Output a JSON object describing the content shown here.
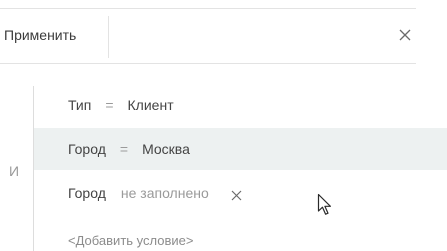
{
  "toolbar": {
    "apply_label": "Применить",
    "close_icon": "close-icon"
  },
  "logic": {
    "label": "И"
  },
  "conditions": [
    {
      "field": "Тип",
      "operator": "=",
      "value": "Клиент"
    },
    {
      "field": "Город",
      "operator": "=",
      "value": "Москва"
    },
    {
      "field": "Город",
      "operator": "не заполнено",
      "value": ""
    }
  ],
  "add_condition_label": "<Добавить условие>",
  "icons": {
    "clear": "clear-condition-icon",
    "cursor": "mouse-cursor-icon"
  },
  "colors": {
    "row_alt_background": "#edf1f1",
    "muted_text": "#9a9a9a",
    "text": "#444444",
    "divider": "#e3e3e3"
  }
}
